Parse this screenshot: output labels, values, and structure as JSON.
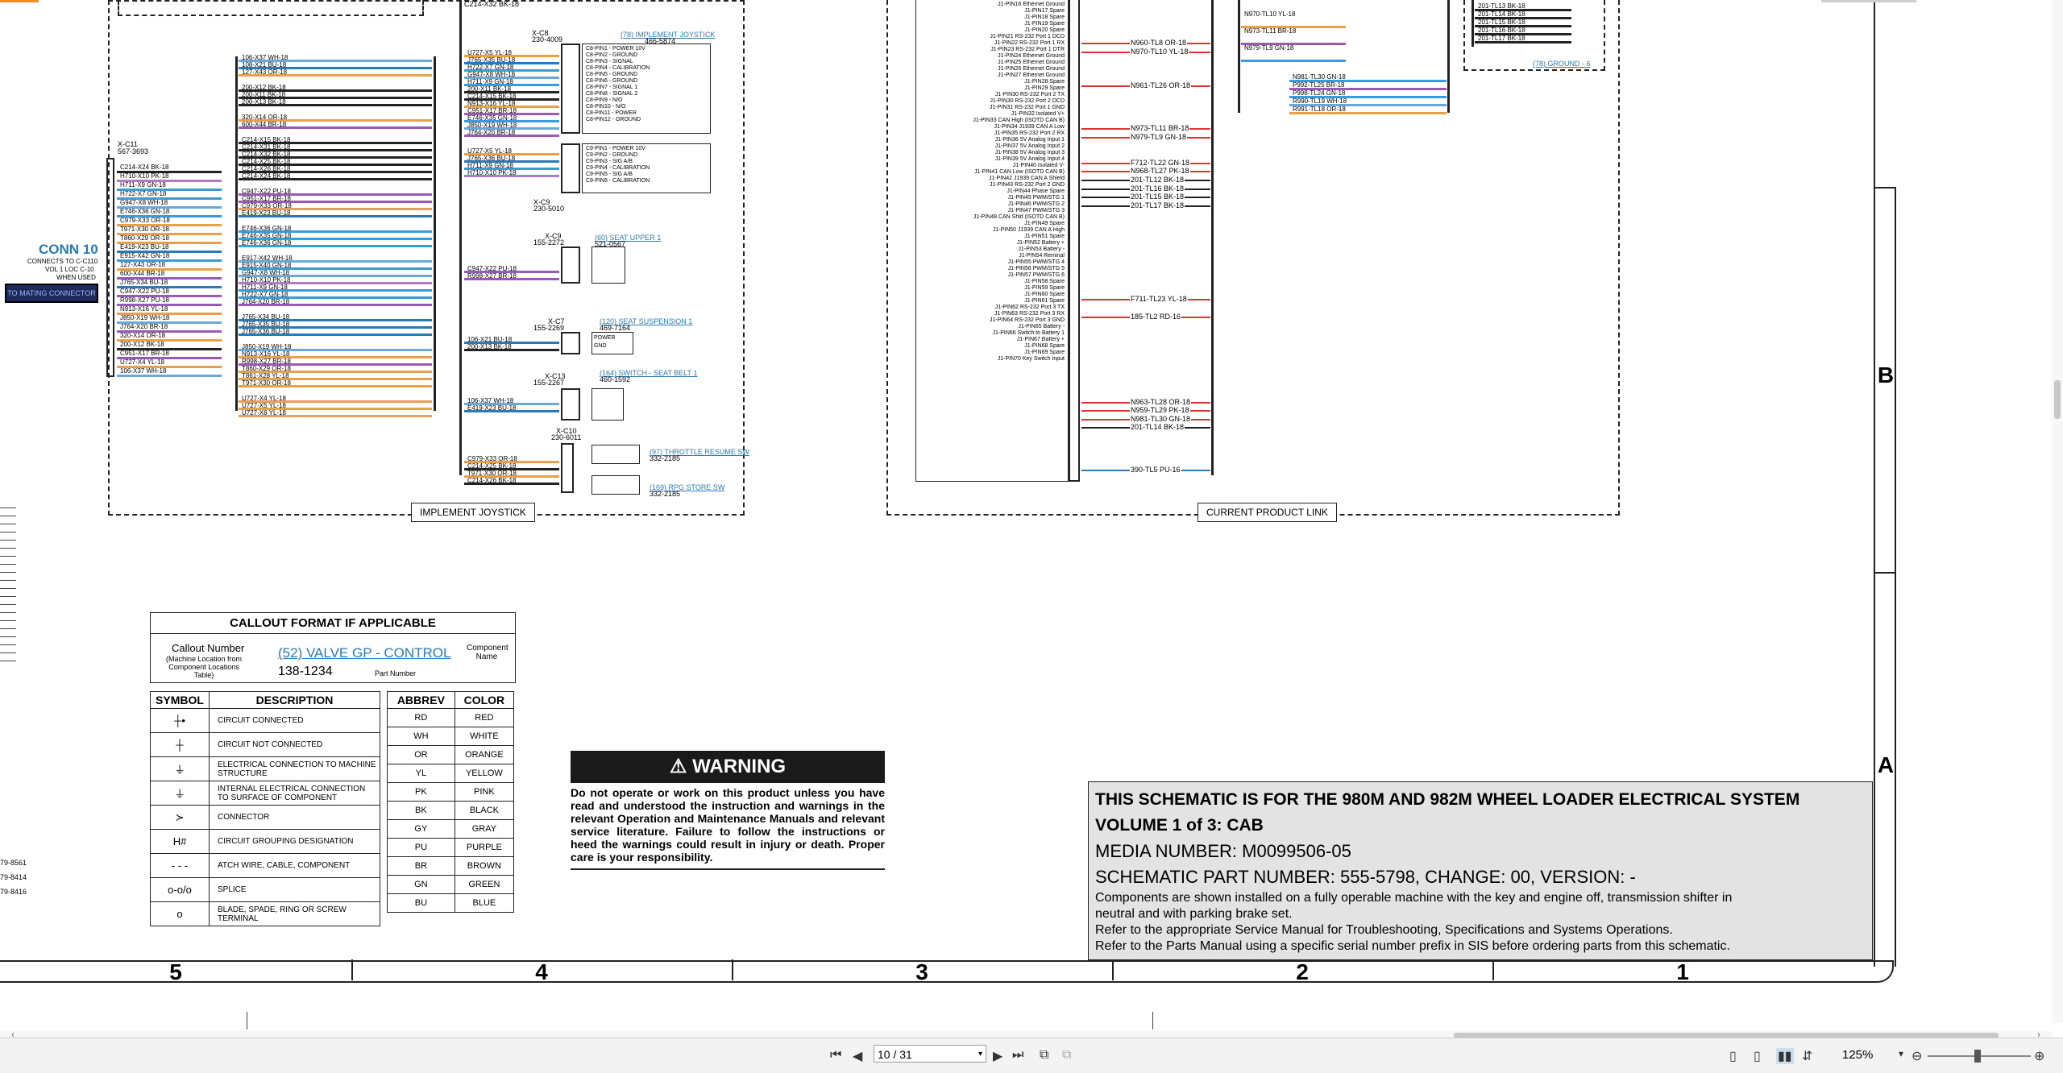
{
  "schematic": {
    "conn10": {
      "title": "CONN 10",
      "sub1": "CONNECTS TO C-C110",
      "sub2": "VOL 1 LOC C-10",
      "sub3": "WHEN USED",
      "button": "TO MATING CONNECTOR"
    },
    "xc11": {
      "id": "X-C11",
      "pn": "567-3693"
    },
    "left_wires": [
      "C214-X24 BK-18",
      "H710-X10 PK-18",
      "H711-X9 GN-18",
      "H722-X7 GN-18",
      "G947-X8 WH-18",
      "E746-X36 GN-18",
      "C979-X33 OR-18",
      "T971-X30 OR-18",
      "T860-X29 OR-18",
      "E419-X23 BU-18",
      "E915-X42 GN-18",
      "127-X43 OR-18",
      "600-X44 BR-18",
      "J765-X34 BU-18",
      "C947-X22 PU-18",
      "R998-X27 PU-18",
      "N913-X16 YL-18",
      "J850-X19 WH-18",
      "J764-X20 BR-18",
      "320-X14 OR-18",
      "200-X12 BK-18",
      "C951-X17 BR-18",
      "U727-X4 YL-18",
      "106-X37 WH-18"
    ],
    "mid_top_wires": [
      "106-X37 WH-18",
      "108-X21 BU-18",
      "127-X43 OR-18"
    ],
    "mid_wires_a": [
      "200-X12 BK-18",
      "200-X11 BK-18",
      "200-X13 BK-18"
    ],
    "mid_wires_b": [
      "320-X14 OR-18",
      "600-X44 BR-18"
    ],
    "mid_wires_c": [
      "C214-X15 BK-18",
      "C214-X31 BK-18",
      "C214-X32 BK-18",
      "C214-X25 BK-18",
      "C214-X26 BK-18",
      "C214-X24 BK-18"
    ],
    "mid_wires_d": [
      "C947-X22 PU-18",
      "C951-X17 BR-18",
      "C979-X33 OR-18",
      "E419-X23 BU-18"
    ],
    "mid_wires_e": [
      "E746-X36 GN-18",
      "E746-X35 GN-18",
      "E746-X36 GN-18"
    ],
    "mid_wires_f": [
      "E917-X42 WH-18",
      "E915-X40 GN-18",
      "G947-X8 WH-18",
      "H710-X10 PK-18",
      "H711-X9 GN-18",
      "H722-X7 GN-18",
      "J764-X20 BR-18"
    ],
    "mid_wires_g": [
      "J765-X34 BU-18",
      "J765-X35 BU-18",
      "J765-X36 BU-18"
    ],
    "mid_wires_h": [
      "J850-X19 WH-18",
      "N913-X16 YL-18",
      "R998-X27 BR-18",
      "T860-X29 OR-18",
      "T861-X28 YL-18",
      "T971-X30 OR-18"
    ],
    "mid_wires_i": [
      "U727-X4 YL-18",
      "U727-X5 YL-18",
      "U727-X6 YL-18"
    ],
    "joy_top_wires": [
      "C214-X32 BK-18"
    ],
    "joy_wires_1": [
      "U727-X5 YL-18",
      "J765-X35 BU-18",
      "H722-X7 GN-18",
      "G947-X8 WH-18",
      "H711-X9 GN-18",
      "200-X11 BK-18",
      "C214-X15 BK-18",
      "N913-X16 YL-18",
      "C951-X17 BR-18",
      "E746-X35 GN-18",
      "J850-X19 WH-18",
      "J764-X20 BR-18"
    ],
    "joy_wires_2": [
      "U727-X5 YL-18",
      "J765-X36 BU-18",
      "H711-X9 GN-18",
      "H710-X10 PK-18"
    ],
    "joy_wires_3": [
      "C947-X22 PU-18",
      "R998-X27 BR-18"
    ],
    "joy_wires_4": [
      "106-X21 BU-18",
      "200-X13 BK-18"
    ],
    "joy_wires_5": [
      "106-X37 WH-18",
      "E419-X23 BU-18"
    ],
    "joy_wires_6": [
      "C979-X33 OR-18",
      "C214-X25 BK-18",
      "T971-X30 OR-18",
      "C214-X26 BK-18"
    ],
    "xc8": {
      "id": "X-C8",
      "pn": "230-4009",
      "link": "(78) IMPLEMENT JOYSTICK",
      "linkpn": "466-5874"
    },
    "xc8_pins": [
      "C8-PIN1 - POWER 10V",
      "C8-PIN2 - GROUND",
      "C8-PIN3 - SIGNAL",
      "C8-PIN4 - CALIBRATION",
      "C8-PIN5 - GROUND",
      "C8-PIN6 - GROUND",
      "C8-PIN7 - SIGNAL 1",
      "C8-PIN8 - SIGNAL 2",
      "C8-PIN9 - N/O",
      "C8-PIN10 - N/O",
      "C8-PIN11 - POWER",
      "C8-PIN12 - GROUND"
    ],
    "xc9": {
      "id": "X-C9",
      "pn": "230-5010"
    },
    "xc9_pins": [
      "C9-PIN1 - POWER 10V",
      "C9-PIN2 - GROUND",
      "C9-PIN3 - SIG A/B",
      "C9-PIN4 - CALIBRATION",
      "C9-PIN5 - SIG A/B",
      "C9-PIN6 - CALIBRATION"
    ],
    "xc9b": {
      "id": "X-C9",
      "pn": "155-2272",
      "link": "(60) SEAT UPPER 1",
      "linkpn": "521-0567"
    },
    "xc7": {
      "id": "X-C7",
      "pn": "155-2269",
      "link": "(120) SEAT SUSPENSION 1",
      "linkpn": "469-7164",
      "p1": "POWER",
      "p2": "GND"
    },
    "xc13": {
      "id": "X-C13",
      "pn": "155-2267",
      "link": "(164) SWITCH - SEAT BELT 1",
      "linkpn": "460-1592"
    },
    "xc10": {
      "id": "X-C10",
      "pn": "230-6011",
      "link1": "(97) THROTTLE RESUME SW",
      "pn1": "332-2185",
      "link2": "(169) RPG STORE SW",
      "pn2": "332-2185"
    },
    "frame1_label": "IMPLEMENT JOYSTICK",
    "frame2_label": "CURRENT PRODUCT LINK",
    "pl_pins": [
      "J1-PIN16 Ethernet Ground",
      "J1-PIN17 Spare",
      "J1-PIN18 Spare",
      "J1-PIN19 Spare",
      "J1-PIN20 Spare",
      "J1-PIN21 RS-232 Port 1 DCD",
      "J1-PIN22 RS-232 Port 1 RX",
      "J1-PIN23 RS-232 Port 1 DTR",
      "J1-PIN24 Ethernet Ground",
      "J1-PIN25 Ethernet Ground",
      "J1-PIN26 Ethernet Ground",
      "J1-PIN27 Ethernet Ground",
      "J1-PIN28 Spare",
      "J1-PIN29 Spare",
      "J1-PIN30 RS-232 Port 2 TX",
      "J1-PIN30 RS-232 Port 2 DCD",
      "J1-PIN31 RS-232 Port 1 GND",
      "J1-PIN32 Isolated V+",
      "J1-PIN33 CAN High (ISOTD CAN B)",
      "J1-PIN34 J1939 CAN A Low",
      "J1-PIN35 RS-232 Port 2 RX",
      "J1-PIN36 5V Analog Input 1",
      "J1-PIN37 5V Analog Input 2",
      "J1-PIN38 5V Analog Input 3",
      "J1-PIN39 5V Analog Input 4",
      "J1-PIN40 Isolated V-",
      "J1-PIN41 CAN Low (ISOTD CAN B)",
      "J1-PIN42 J1939 CAN A Shield",
      "J1-PIN43 RS-232 Port 2 GND",
      "J1-PIN44 Phase Spare",
      "J1-PIN45 PWM/STG 1",
      "J1-PIN46 PWM/STG 2",
      "J1-PIN47 PWM/STG 3",
      "J1-PIN48 CAN Shld (ISOTD CAN B)",
      "J1-PIN49 Spare",
      "J1-PIN50 J1939 CAN A High",
      "J1-PIN51 Spare",
      "J1-PIN52 Battery +",
      "J1-PIN53 Battery -",
      "J1-PIN54 Reminal",
      "J1-PIN55 PWM/STG 4",
      "J1-PIN56 PWM/STG 5",
      "J1-PIN57 PWM/STG 6",
      "J1-PIN58 Spare",
      "J1-PIN59 Spare",
      "J1-PIN60 Spare",
      "J1-PIN61 Spare",
      "J1-PIN62 RS-232 Port 3 TX",
      "J1-PIN63 RS-232 Port 3 RX",
      "J1-PIN64 RS-232 Port 3 GND",
      "J1-PIN65 Battery -",
      "J1-PIN66 Switch to Battery 1",
      "J1-PIN67 Battery +",
      "J1-PIN68 Spare",
      "J1-PIN69 Spare",
      "J1-PIN70 Key Switch Input"
    ],
    "pl_wires": [
      {
        "row": 4,
        "label": "N960-TL8 OR-18",
        "color": "#d33"
      },
      {
        "row": 5,
        "label": "N970-TL10 YL-18",
        "color": "#d33"
      },
      {
        "row": 9,
        "label": "N961-TL26 OR-18",
        "color": "#d33"
      },
      {
        "row": 14,
        "label": "N973-TL11 BR-18",
        "color": "#d33"
      },
      {
        "row": 15,
        "label": "N979-TL9 GN-18",
        "color": "#d33"
      },
      {
        "row": 18,
        "label": "F712-TL22 GN-18",
        "color": "#d33"
      },
      {
        "row": 19,
        "label": "N968-TL27 PK-18",
        "color": "#d33"
      },
      {
        "row": 20,
        "label": "201-TL12 BK-18",
        "color": "#222"
      },
      {
        "row": 21,
        "label": "201-TL16 BK-18",
        "color": "#222"
      },
      {
        "row": 22,
        "label": "201-TL15 BK-18",
        "color": "#222"
      },
      {
        "row": 23,
        "label": "201-TL17 BK-18",
        "color": "#222"
      },
      {
        "row": 34,
        "label": "F711-TL23 YL-18",
        "color": "#d33"
      },
      {
        "row": 36,
        "label": "185-TL2 RD-16",
        "color": "#d33"
      },
      {
        "row": 46,
        "label": "N963-TL28 OR-18",
        "color": "#d33"
      },
      {
        "row": 47,
        "label": "N959-TL29 PK-18",
        "color": "#d33"
      },
      {
        "row": 48,
        "label": "N981-TL30 GN-18",
        "color": "#d33"
      },
      {
        "row": 49,
        "label": "201-TL14 BK-18",
        "color": "#222"
      },
      {
        "row": 54,
        "label": "390-TL5 PU-16",
        "color": "#2a7ab8"
      }
    ],
    "pl_top_wires": [
      "N970-TL10 YL-18",
      "N973-TL11 BR-18",
      "N979-TL9 GN-18"
    ],
    "pl_top_wires2": [
      "N981-TL30 GN-18",
      "P992-TL25 BR-18",
      "P998-TL24 GN-18",
      "R990-TL19 WH-18",
      "R991-TL18 OR-18"
    ],
    "pl_top_wires3": [
      "201-TL13 BK-18",
      "201-TL14 BK-18",
      "201-TL15 BK-18",
      "201-TL16 BK-18",
      "201-TL17 BK-18"
    ],
    "ground_link": "(78) GROUND - 6",
    "left_refs": [
      "79-8561",
      "79-8414",
      "79-8416"
    ]
  },
  "callout": {
    "title": "CALLOUT FORMAT IF APPLICABLE",
    "callout_number": "Callout Number",
    "callout_sub": "(Machine Location from Component Locations Table)",
    "example": "(52) VALVE GP - CONTROL",
    "component_name": "Component Name",
    "part_no": "138-1234",
    "part_label": "Part Number"
  },
  "symbols": {
    "h1": "SYMBOL",
    "h2": "DESCRIPTION",
    "rows": [
      {
        "sym": "┼•",
        "desc": "CIRCUIT CONNECTED"
      },
      {
        "sym": "┼",
        "desc": "CIRCUIT NOT CONNECTED"
      },
      {
        "sym": "⏚",
        "desc": "ELECTRICAL CONNECTION TO MACHINE STRUCTURE"
      },
      {
        "sym": "⏚",
        "desc": "INTERNAL ELECTRICAL CONNECTION TO SURFACE OF COMPONENT"
      },
      {
        "sym": "≻",
        "desc": "CONNECTOR"
      },
      {
        "sym": "H#",
        "desc": "CIRCUIT GROUPING DESIGNATION"
      },
      {
        "sym": "- - -",
        "desc": "ATCH WIRE, CABLE, COMPONENT"
      },
      {
        "sym": "o-o/o",
        "desc": "SPLICE"
      },
      {
        "sym": "o",
        "desc": "BLADE, SPADE, RING OR SCREW TERMINAL"
      }
    ]
  },
  "colors": {
    "h1": "ABBREV",
    "h2": "COLOR",
    "rows": [
      [
        "RD",
        "RED"
      ],
      [
        "WH",
        "WHITE"
      ],
      [
        "OR",
        "ORANGE"
      ],
      [
        "YL",
        "YELLOW"
      ],
      [
        "PK",
        "PINK"
      ],
      [
        "BK",
        "BLACK"
      ],
      [
        "GY",
        "GRAY"
      ],
      [
        "PU",
        "PURPLE"
      ],
      [
        "BR",
        "BROWN"
      ],
      [
        "GN",
        "GREEN"
      ],
      [
        "BU",
        "BLUE"
      ]
    ]
  },
  "warning": {
    "title": "WARNING",
    "text": "Do not operate or work on this product unless you have read and understood the instruction and warnings in the relevant Operation and Maintenance Manuals and relevant service literature. Failure to follow the instructions or heed the warnings could result in injury or death. Proper care is your responsibility."
  },
  "titleblock": {
    "line1": "THIS SCHEMATIC IS FOR THE 980M AND 982M WHEEL LOADER ELECTRICAL SYSTEM",
    "line2": "VOLUME 1 of 3: CAB",
    "line3": "MEDIA NUMBER: M0099506-05",
    "line4": "SCHEMATIC PART NUMBER: 555-5798, CHANGE: 00, VERSION: -",
    "line5": "Components are shown installed on a fully operable machine with the key and engine off, transmission shifter in neutral and with parking brake set.",
    "line6": "Refer to the appropriate Service Manual for Troubleshooting, Specifications and Systems Operations.",
    "line7": "Refer to the Parts Manual using a specific serial number prefix in SIS before ordering parts from this schematic."
  },
  "zones": {
    "cols": [
      "5",
      "4",
      "3",
      "2",
      "1"
    ],
    "rows": [
      "B",
      "A"
    ]
  },
  "viewer": {
    "page": "10 / 31",
    "zoom": "125%"
  }
}
